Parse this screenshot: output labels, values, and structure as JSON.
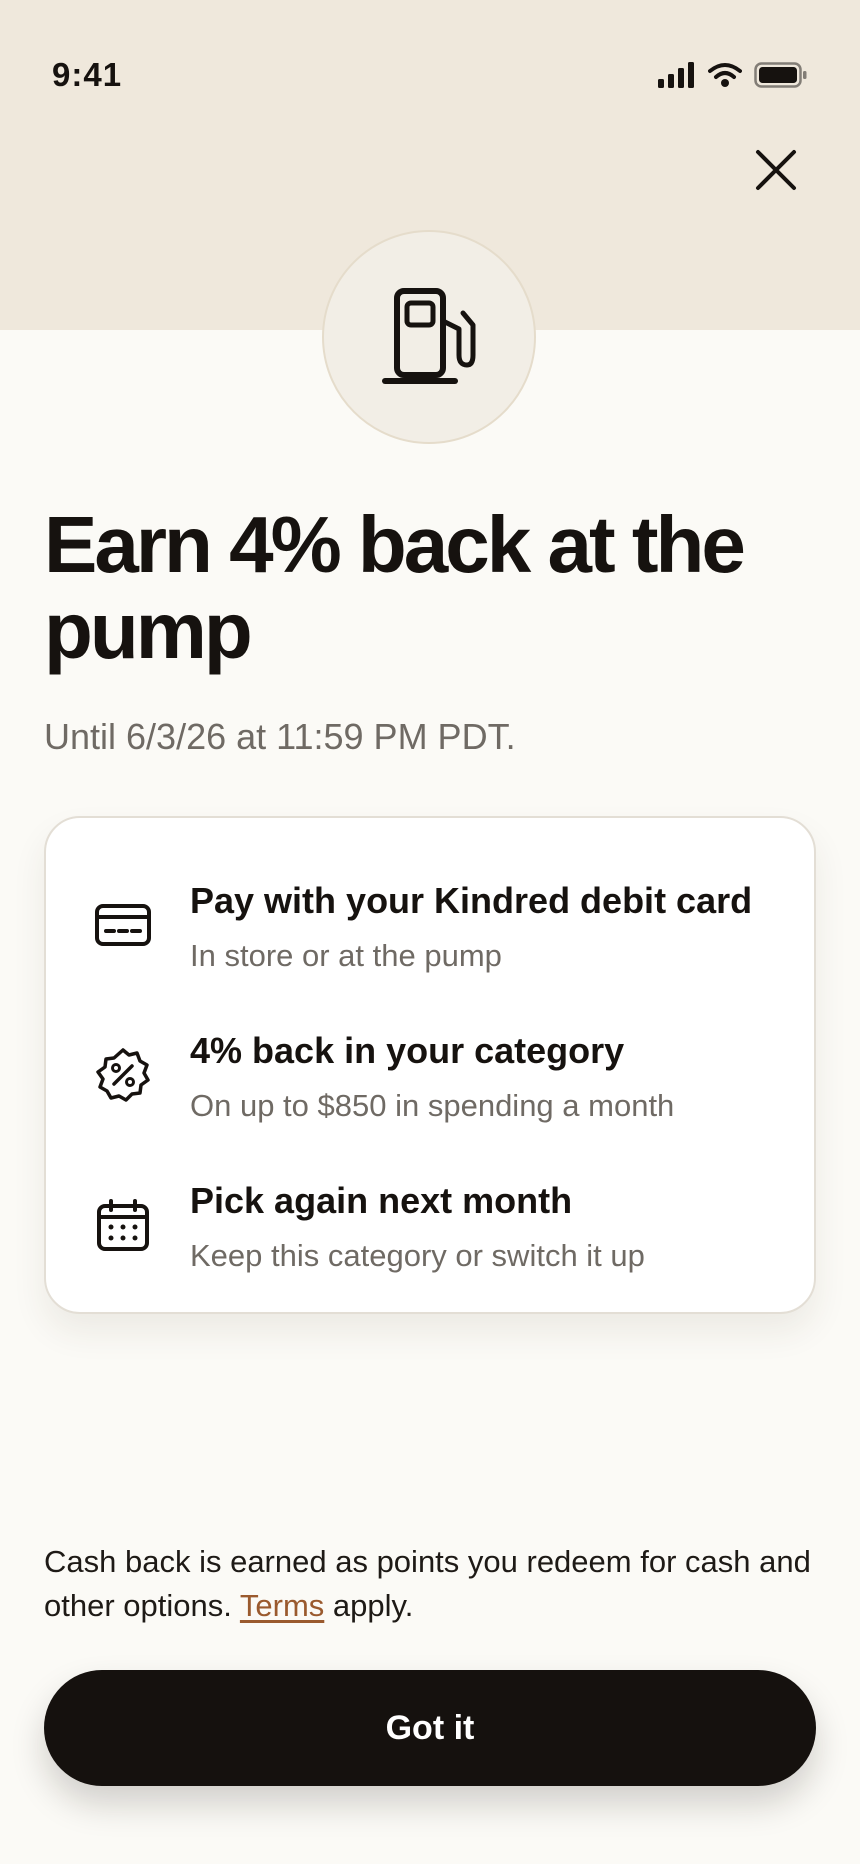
{
  "status_bar": {
    "time": "9:41",
    "icons": [
      "cellular-signal-icon",
      "wifi-icon",
      "battery-icon"
    ]
  },
  "header": {
    "close_icon": "close-icon",
    "hero_icon": "gas-pump-icon"
  },
  "offer": {
    "title": "Earn 4% back at the pump",
    "subtitle": "Until 6/3/26 at 11:59 PM PDT."
  },
  "steps": [
    {
      "icon": "credit-card-icon",
      "title": "Pay with your Kindred debit card",
      "description": "In store or at the pump"
    },
    {
      "icon": "percent-badge-icon",
      "title": "4% back in your category",
      "description": "On up to $850 in spending a month"
    },
    {
      "icon": "calendar-icon",
      "title": "Pick again next month",
      "description": "Keep this category or switch it up"
    }
  ],
  "disclaimer": {
    "text_before": "Cash back is earned as points you redeem for cash and other options. ",
    "link_label": "Terms",
    "text_after": " apply."
  },
  "cta": {
    "label": "Got it"
  },
  "colors": {
    "hero_band": "#EFE8DC",
    "background": "#FBFAF6",
    "primary_text": "#16120F",
    "secondary_text": "#6F6A64",
    "link": "#9A5A2E",
    "button": "#15110E"
  }
}
